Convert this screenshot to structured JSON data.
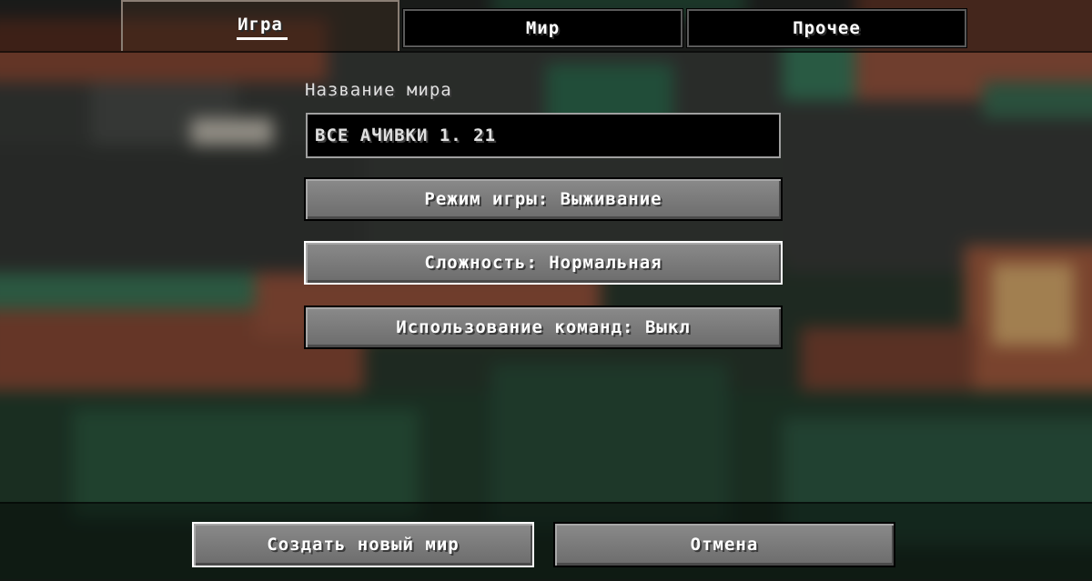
{
  "tabs": [
    {
      "label": "Игра",
      "active": true
    },
    {
      "label": "Мир",
      "active": false
    },
    {
      "label": "Прочее",
      "active": false
    }
  ],
  "world_name": {
    "label": "Название мира",
    "value": "ВСЕ АЧИВКИ 1. 21"
  },
  "options": {
    "gamemode": "Режим игры: Выживание",
    "difficulty": "Сложность: Нормальная",
    "commands": "Использование команд: Выкл"
  },
  "footer": {
    "create_label": "Создать новый мир",
    "cancel_label": "Отмена"
  },
  "colors": {
    "button_face": "#7a7a7a",
    "button_border": "#000000",
    "hover_border": "#ffffff",
    "input_bg": "#000000",
    "copper": "#b5694a",
    "oxidized_copper": "#2f6b4f"
  }
}
